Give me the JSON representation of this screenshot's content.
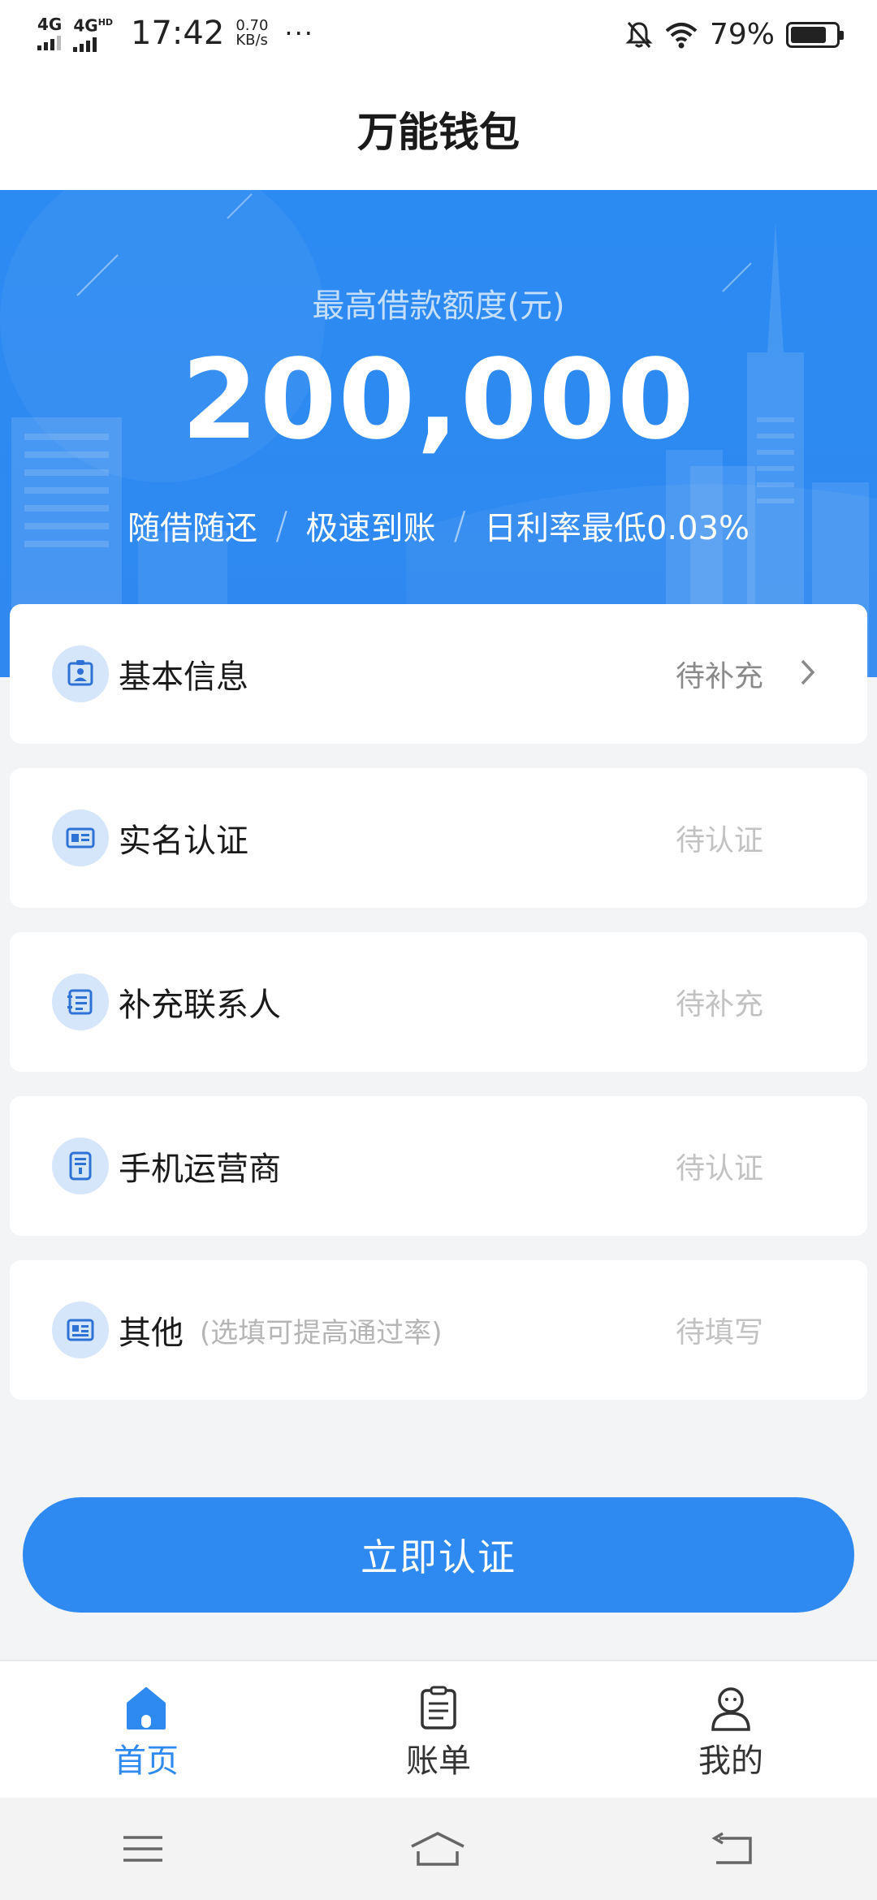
{
  "status_bar": {
    "net1": "4G",
    "net2": "4G",
    "net2_sup": "HD",
    "time": "17:42",
    "speed_value": "0.70",
    "speed_unit": "KB/s",
    "more": "···",
    "battery_text": "79%",
    "battery_level": 0.79
  },
  "header": {
    "title": "万能钱包"
  },
  "hero": {
    "label": "最高借款额度(元)",
    "amount": "200,000",
    "features": [
      "随借随还",
      "极速到账",
      "日利率最低0.03%"
    ],
    "separator": "/"
  },
  "items": [
    {
      "name": "基本信息",
      "note": "",
      "status": "待补充",
      "icon": "profile-icon"
    },
    {
      "name": "实名认证",
      "note": "",
      "status": "待认证",
      "icon": "id-card-icon"
    },
    {
      "name": "补充联系人",
      "note": "",
      "status": "待补充",
      "icon": "contacts-icon"
    },
    {
      "name": "手机运营商",
      "note": "",
      "status": "待认证",
      "icon": "phone-carrier-icon"
    },
    {
      "name": "其他",
      "note": "(选填可提高通过率)",
      "status": "待填写",
      "icon": "other-icon"
    }
  ],
  "cta": {
    "label": "立即认证"
  },
  "tabs": [
    {
      "label": "首页",
      "icon": "home-icon",
      "active": true
    },
    {
      "label": "账单",
      "icon": "bill-icon",
      "active": false
    },
    {
      "label": "我的",
      "icon": "user-icon",
      "active": false
    }
  ],
  "colors": {
    "primary": "#2e8af0",
    "hero_bg": "#2b8bf2",
    "icon_bg": "#d5e6fb"
  }
}
